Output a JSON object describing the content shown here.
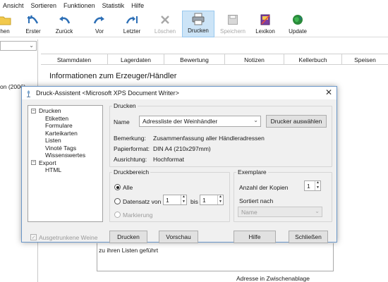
{
  "menu": [
    "Ansicht",
    "Sortieren",
    "Funktionen",
    "Statistik",
    "Hilfe"
  ],
  "toolbar": {
    "items": [
      {
        "label": "hen",
        "icon": "open-folder-icon",
        "enabled": true
      },
      {
        "label": "Erster",
        "icon": "first-icon",
        "enabled": true
      },
      {
        "label": "Zurück",
        "icon": "back-icon",
        "enabled": true
      },
      {
        "label": "Vor",
        "icon": "forward-icon",
        "enabled": true
      },
      {
        "label": "Letzter",
        "icon": "last-icon",
        "enabled": true
      },
      {
        "label": "Löschen",
        "icon": "delete-icon",
        "enabled": false
      },
      {
        "label": "Drucken",
        "icon": "printer-icon",
        "enabled": true,
        "active": true
      },
      {
        "label": "Speichern",
        "icon": "save-icon",
        "enabled": false
      },
      {
        "label": "Lexikon",
        "icon": "lexicon-icon",
        "enabled": true
      },
      {
        "label": "Update",
        "icon": "globe-icon",
        "enabled": true
      }
    ]
  },
  "left_panel": {
    "text": "on (2006)"
  },
  "main": {
    "tabs": [
      "Stammdaten",
      "Lagerdaten",
      "Bewertung",
      "Notizen",
      "Kellerbuch",
      "Speisen"
    ],
    "heading": "Informationen zum Erzeuger/Händler"
  },
  "background": {
    "fragment": "zu ihren Listen geführt",
    "clipboard": "Adresse in Zwischenablage"
  },
  "dialog": {
    "title": "Druck-Assistent <Microsoft XPS Document Writer>",
    "close_icon": "close-icon",
    "tree": [
      {
        "label": "Drucken",
        "level": 0,
        "expander": "−"
      },
      {
        "label": "Etiketten",
        "level": 1
      },
      {
        "label": "Formulare",
        "level": 1
      },
      {
        "label": "Karteikarten",
        "level": 1
      },
      {
        "label": "Listen",
        "level": 1
      },
      {
        "label": "Vinoté Tags",
        "level": 1
      },
      {
        "label": "Wissenswertes",
        "level": 1
      },
      {
        "label": "Export",
        "level": 0,
        "expander": "−"
      },
      {
        "label": "HTML",
        "level": 1
      }
    ],
    "drucken": {
      "legend": "Drucken",
      "name_label": "Name",
      "name_value": "Adressliste der Weinhändler",
      "select_printer": "Drucker auswählen",
      "bemerkung_label": "Bemerkung:",
      "bemerkung_value": "Zusammenfassung aller Händleradressen",
      "papierformat_label": "Papierformat:",
      "papierformat_value": "DIN A4 (210x297mm)",
      "ausrichtung_label": "Ausrichtung:",
      "ausrichtung_value": "Hochformat"
    },
    "druckbereich": {
      "legend": "Druckbereich",
      "alle": "Alle",
      "datensatz_von": "Datensatz von",
      "von_value": "1",
      "bis_label": "bis",
      "bis_value": "1",
      "markierung": "Markierung"
    },
    "exemplare": {
      "legend": "Exemplare",
      "anzahl_label": "Anzahl der Kopien",
      "anzahl_value": "1",
      "sortiert_label": "Sortiert nach",
      "sortiert_value": "Name"
    },
    "footer": {
      "ausgetrunkene": "Ausgetrunkene Weine",
      "drucken": "Drucken",
      "vorschau": "Vorschau",
      "hilfe": "Hilfe",
      "schliessen": "Schließen"
    }
  }
}
